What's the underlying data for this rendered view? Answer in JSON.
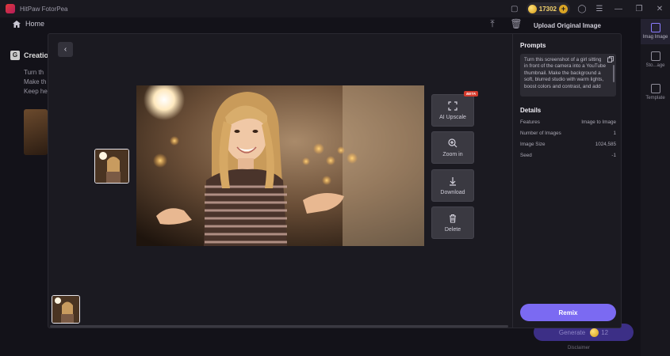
{
  "app": {
    "title": "HitPaw FotorPea",
    "credits": "17302",
    "home_label": "Home"
  },
  "background": {
    "left_title": "Creatio",
    "left_lines": [
      "Turn th",
      "Make th",
      "Keep he"
    ],
    "right_title": "Upload Original Image",
    "rail": [
      {
        "label": "Imag Image",
        "icon": "image-to-image-icon"
      },
      {
        "label": "Sto...age",
        "icon": "edit-image-icon"
      },
      {
        "label": "Template",
        "icon": "template-icon"
      }
    ],
    "generate_label": "Generate",
    "generate_cost": "12",
    "disclaimer": "Disclaimer"
  },
  "viewer": {
    "actions": [
      {
        "label": "AI Upscale",
        "icon": "expand-icon",
        "badge": "BETA"
      },
      {
        "label": "Zoom in",
        "icon": "zoom-in-icon"
      },
      {
        "label": "Download",
        "icon": "download-icon"
      },
      {
        "label": "Delete",
        "icon": "trash-icon"
      }
    ]
  },
  "panel": {
    "prompts_title": "Prompts",
    "prompt_text": "Turn this screenshot of a girl sitting in front of the camera into a YouTube thumbnail. Make the background a soft, blurred studio with warm lights, boost colors and contrast, and add",
    "details_title": "Details",
    "details": [
      {
        "label": "Features",
        "value": "Image to Image"
      },
      {
        "label": "Number of Images",
        "value": "1"
      },
      {
        "label": "Image Size",
        "value": "1024,585"
      },
      {
        "label": "Seed",
        "value": "-1"
      }
    ],
    "remix_label": "Remix"
  },
  "colors": {
    "accent": "#7b6af2",
    "beta_badge": "#d33a2c",
    "credits_text": "#f3d26b"
  }
}
